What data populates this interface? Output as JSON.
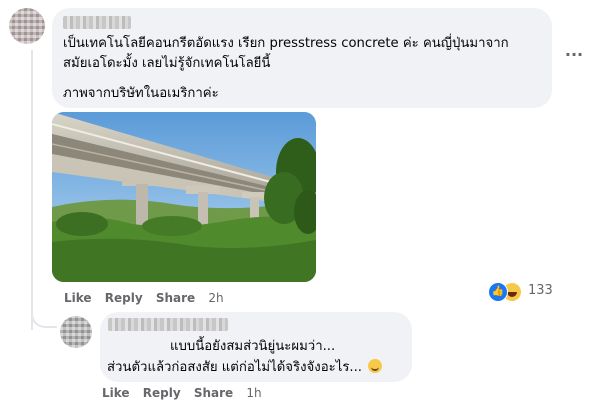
{
  "comments": [
    {
      "text_lines": [
        "เป็นเทคโนโลยีคอนกรีตอัดแรง เรียก presstress concrete ค่ะ คนญี่ปุ่นมาจาก",
        "สมัยเอโดะมั้ง เลยไม่รู้จักเทคโนโลยีนี้",
        "ภาพจากบริษัทในอเมริกาค่ะ"
      ],
      "actions": {
        "like": "Like",
        "reply": "Reply",
        "share": "Share",
        "time": "2h"
      },
      "reactions": {
        "icons": [
          "like-icon",
          "haha-icon"
        ],
        "count": "133"
      },
      "more_icon": "more-horizontal-icon"
    },
    {
      "text_lines": [
        "แบบนี้อยังสมส่วนิยู่นะผมว่า...",
        "ส่วนตัวแล้วก่อสงสัย แต่ก่อไม่ได้จริงจังอะไร..."
      ],
      "emoji": "grinning-face-icon",
      "actions": {
        "like": "Like",
        "reply": "Reply",
        "share": "Share",
        "time": "1h"
      }
    }
  ],
  "colors": {
    "bubble": "#f0f2f5",
    "meta_text": "#65676b",
    "like_blue": "#1877f2",
    "haha_yellow": "#f7c948"
  }
}
